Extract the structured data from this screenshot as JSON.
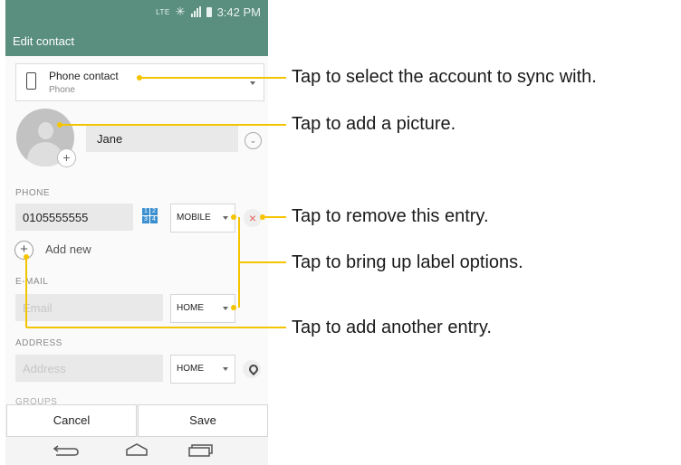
{
  "status_bar": {
    "network": "LTE",
    "time": "3:42 PM"
  },
  "app_bar": {
    "title": "Edit contact"
  },
  "account": {
    "name": "Phone contact",
    "type": "Phone"
  },
  "name_field": {
    "value": "Jane"
  },
  "phone": {
    "section_label": "PHONE",
    "number": "0105555555",
    "keypad_digits": [
      "1",
      "2",
      "3",
      "4"
    ],
    "label": "MOBILE",
    "remove_glyph": "×",
    "add_new": "Add new"
  },
  "email": {
    "section_label": "E-MAIL",
    "placeholder": "Email",
    "label": "HOME"
  },
  "address": {
    "section_label": "ADDRESS",
    "placeholder": "Address",
    "label": "HOME"
  },
  "groups": {
    "section_label": "GROUPS"
  },
  "buttons": {
    "cancel": "Cancel",
    "save": "Save"
  },
  "callouts": [
    "Tap to select the account to sync with.",
    "Tap to add a picture.",
    "Tap to remove this entry.",
    "Tap to bring up label options.",
    "Tap to add another entry."
  ],
  "colors": {
    "app_bar": "#5a8e7e",
    "callout_line": "#f5c400",
    "remove_icon": "#e46060",
    "keypad": "#3a8fd0"
  },
  "icons": [
    "phone-icon",
    "avatar-icon",
    "add-photo-icon",
    "expand-icon",
    "keypad-icon",
    "remove-icon",
    "add-icon",
    "location-pin-icon",
    "back-icon",
    "home-icon",
    "recent-apps-icon"
  ]
}
